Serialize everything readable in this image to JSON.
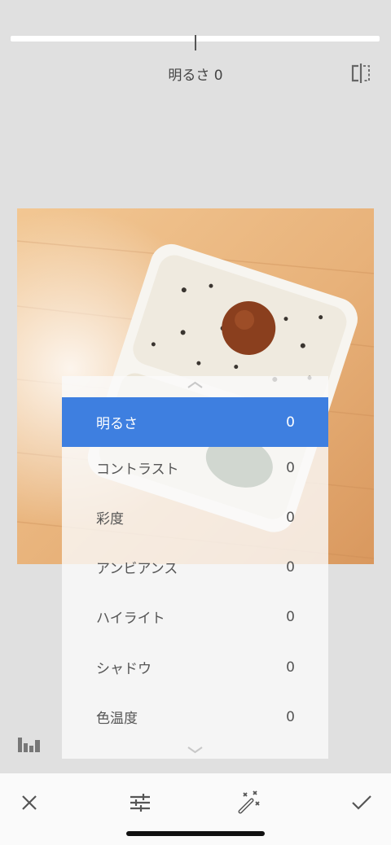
{
  "adjustment": {
    "label": "明るさ 0",
    "value_fraction": 0.5
  },
  "compare_button": {
    "icon": "compare-split-icon"
  },
  "menu": {
    "items": [
      {
        "label": "明るさ",
        "value": "0",
        "active": true
      },
      {
        "label": "コントラスト",
        "value": "0",
        "active": false
      },
      {
        "label": "彩度",
        "value": "0",
        "active": false
      },
      {
        "label": "アンビアンス",
        "value": "0",
        "active": false
      },
      {
        "label": "ハイライト",
        "value": "0",
        "active": false
      },
      {
        "label": "シャドウ",
        "value": "0",
        "active": false
      },
      {
        "label": "色温度",
        "value": "0",
        "active": false
      }
    ],
    "accent_color": "#3e7fe0"
  },
  "bottom_bar": {
    "cancel_icon": "close-icon",
    "tools_icon": "sliders-icon",
    "auto_icon": "magic-wand-icon",
    "apply_icon": "checkmark-icon"
  }
}
